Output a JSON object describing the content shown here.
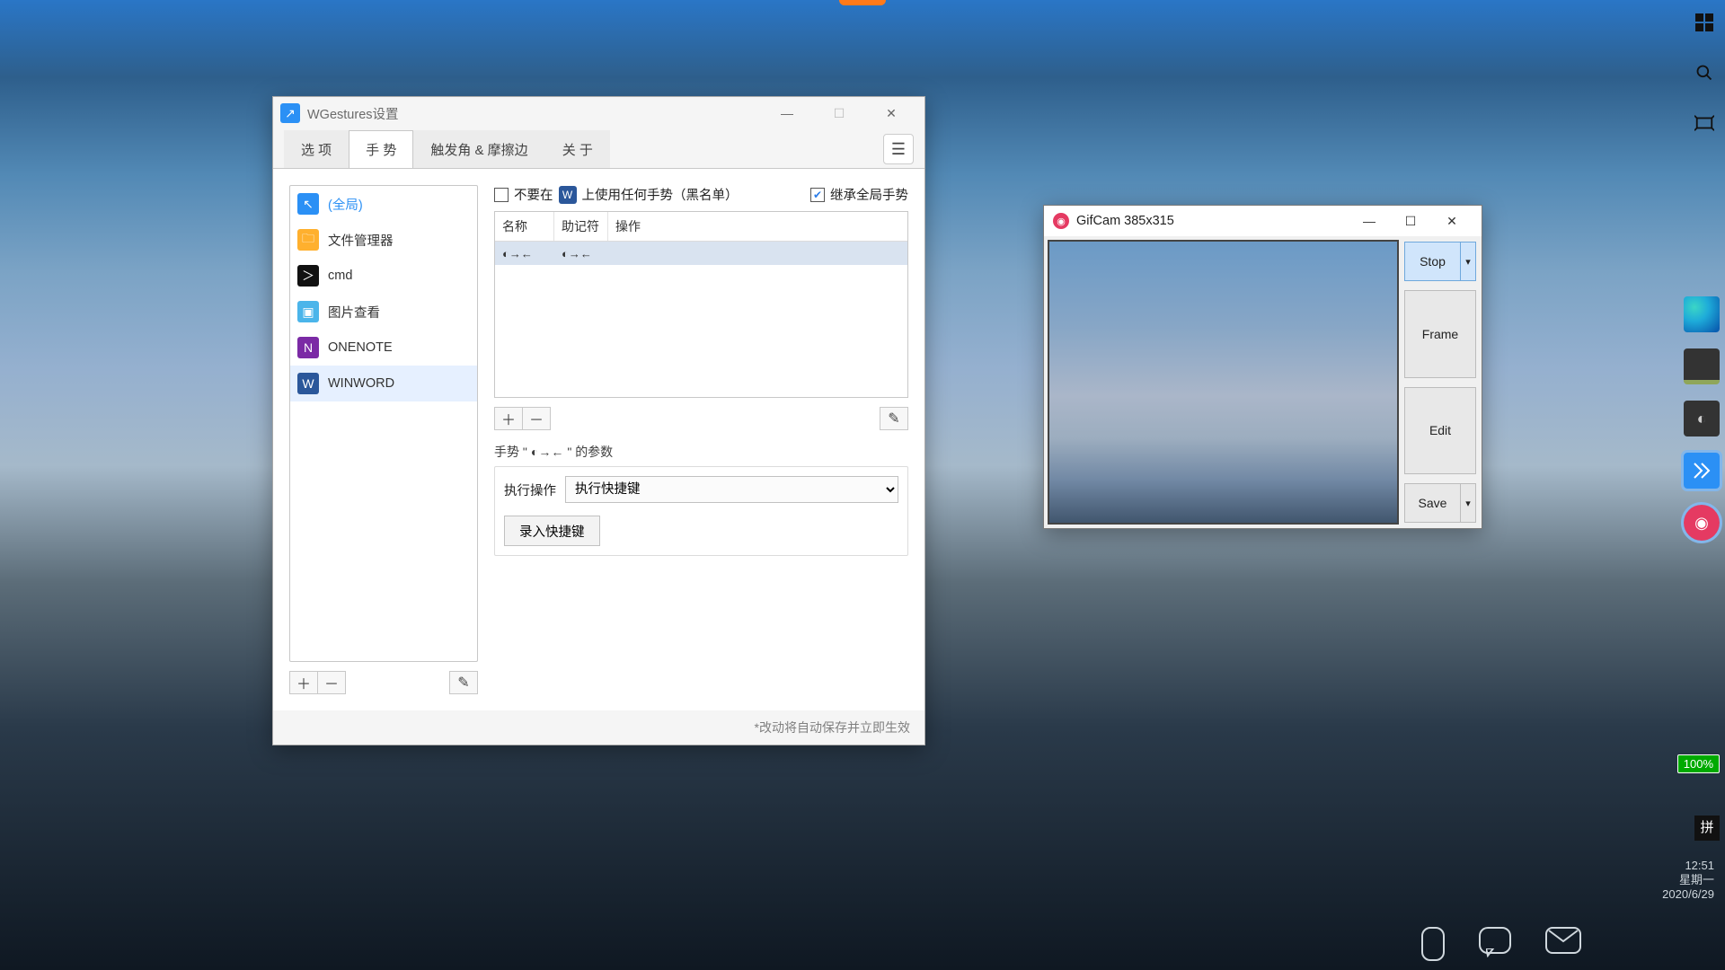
{
  "desktop": {
    "battery": "100%",
    "ime": "拼",
    "clock_time": "12:51",
    "clock_week": "星期一",
    "clock_date": "2020/6/29"
  },
  "wgestures": {
    "title": "WGestures设置",
    "tabs": {
      "options": "选 项",
      "gestures": "手 势",
      "triggers": "触发角 & 摩擦边",
      "about": "关 于"
    },
    "apps": [
      {
        "label": "(全局)",
        "icon": "cursor",
        "color": "#2b90f5",
        "global": true
      },
      {
        "label": "文件管理器",
        "icon": "folder",
        "color": "#ffb02e"
      },
      {
        "label": "cmd",
        "icon": "terminal",
        "color": "#111"
      },
      {
        "label": "图片查看",
        "icon": "image",
        "color": "#4bb5ea"
      },
      {
        "label": "ONENOTE",
        "icon": "N",
        "color": "#7b2aa5"
      },
      {
        "label": "WINWORD",
        "icon": "W",
        "color": "#2b579a",
        "selected": true
      }
    ],
    "checks": {
      "blacklist_prefix": "不要在",
      "blacklist_suffix": "上使用任何手势（黑名单）",
      "inherit": "继承全局手势"
    },
    "table": {
      "col_name": "名称",
      "col_mnemonic": "助记符",
      "col_action": "操作"
    },
    "rows": [
      {
        "name": "◐→←",
        "mnemonic": "◐→←",
        "action": ""
      }
    ],
    "params": {
      "title_prefix": "手势 \"",
      "title_gesture": "◐→←",
      "title_suffix": "\" 的参数",
      "exec_label": "执行操作",
      "exec_value": "执行快捷键",
      "record_btn": "录入快捷键"
    },
    "footer": "*改动将自动保存并立即生效"
  },
  "gifcam": {
    "title": "GifCam 385x315",
    "buttons": {
      "stop": "Stop",
      "frame": "Frame",
      "edit": "Edit",
      "save": "Save"
    }
  }
}
